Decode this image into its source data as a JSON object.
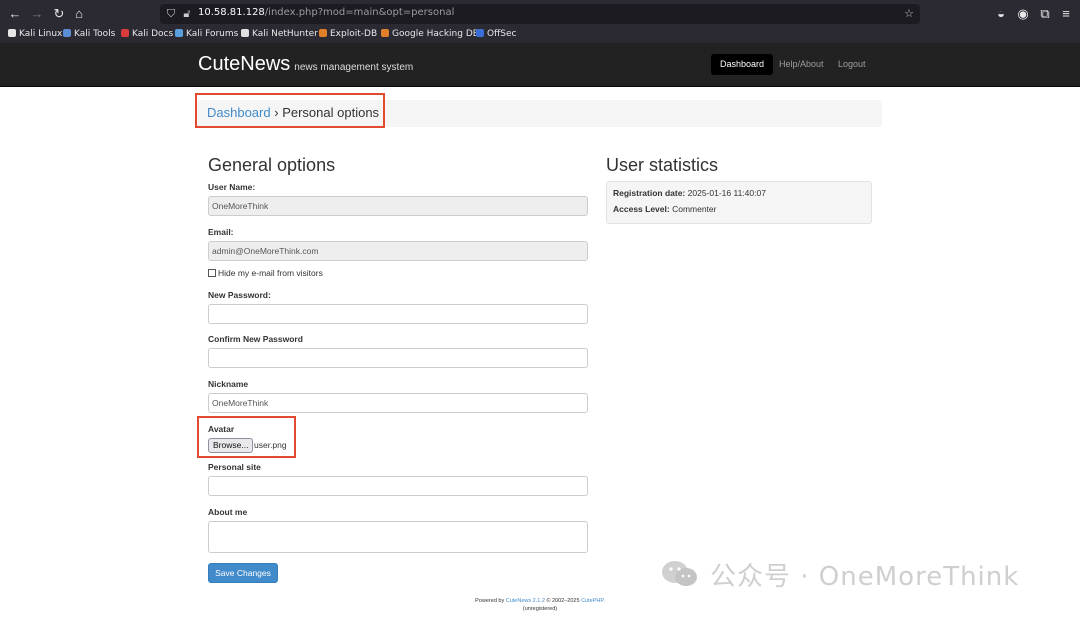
{
  "browser": {
    "url_host": "10.58.81.128",
    "url_path": "/index.php?mod=main&opt=personal",
    "bookmarks": [
      {
        "label": "Kali Linux",
        "icon": "kali-dragon-icon",
        "color": "#e6e6e6"
      },
      {
        "label": "Kali Tools",
        "icon": "kali-tools-icon",
        "color": "#5a8fd8"
      },
      {
        "label": "Kali Docs",
        "icon": "kali-docs-icon",
        "color": "#d93a3a"
      },
      {
        "label": "Kali Forums",
        "icon": "kali-forums-icon",
        "color": "#5aa0e0"
      },
      {
        "label": "Kali NetHunter",
        "icon": "nethunter-icon",
        "color": "#e0e0e0"
      },
      {
        "label": "Exploit-DB",
        "icon": "exploit-db-icon",
        "color": "#e0802a"
      },
      {
        "label": "Google Hacking DB",
        "icon": "ghdb-icon",
        "color": "#e0802a"
      },
      {
        "label": "OffSec",
        "icon": "offsec-icon",
        "color": "#3a6fd8"
      }
    ]
  },
  "site": {
    "brand": "CuteNews",
    "brand_sub": "news management system",
    "nav": {
      "dashboard": "Dashboard",
      "help": "Help/About",
      "logout": "Logout"
    }
  },
  "breadcrumb": {
    "root": "Dashboard",
    "separator": "›",
    "current": "Personal options"
  },
  "general": {
    "title": "General options",
    "username_label": "User Name:",
    "username_value": "OneMoreThink",
    "email_label": "Email:",
    "email_value": "admin@OneMoreThink.com",
    "hide_email_label": "Hide my e-mail from visitors",
    "new_password_label": "New Password:",
    "confirm_password_label": "Confirm New Password",
    "nickname_label": "Nickname",
    "nickname_value": "OneMoreThink",
    "avatar_label": "Avatar",
    "browse_label": "Browse...",
    "avatar_file": "user.png",
    "site_label": "Personal site",
    "about_label": "About me",
    "save_label": "Save Changes"
  },
  "stats": {
    "title": "User statistics",
    "reg_label": "Registration date:",
    "reg_value": "2025-01-16 11:40:07",
    "access_label": "Access Level:",
    "access_value": "Commenter"
  },
  "footer": {
    "powered": "Powered by",
    "product": "CuteNews 2.1.2",
    "copyright": "© 2002–2025",
    "vendor": "CutePHP",
    "period": ".",
    "status": "(unregistered)"
  },
  "watermark": {
    "text": "公众号 · OneMoreThink"
  },
  "colors": {
    "highlight": "#e34a2f",
    "link": "#428bca",
    "primary": "#428bca"
  }
}
